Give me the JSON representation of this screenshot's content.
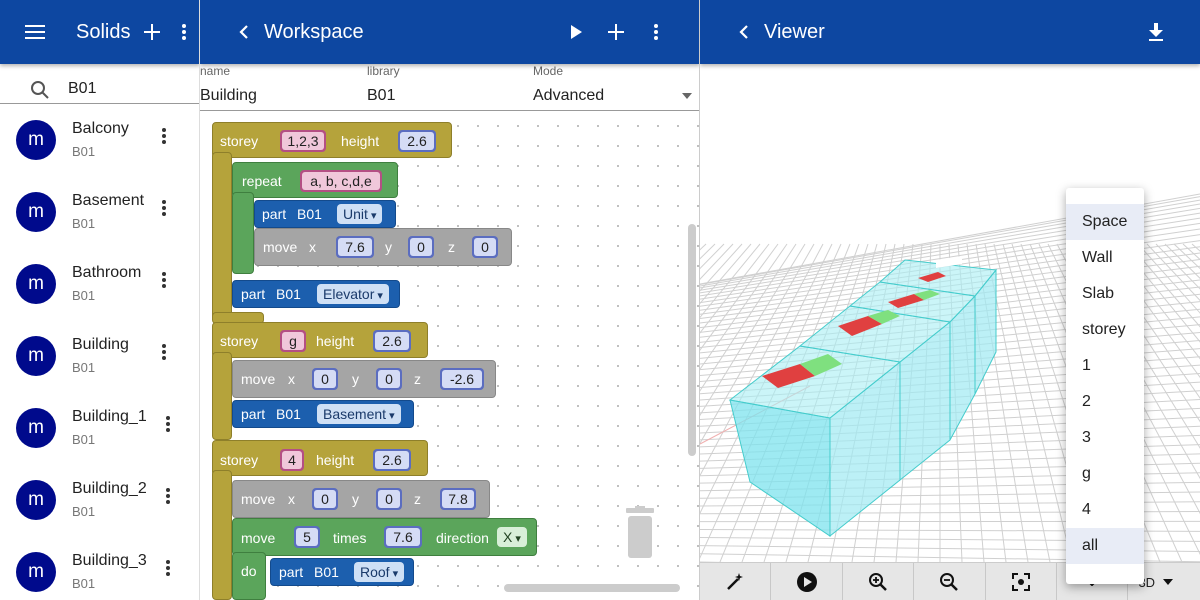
{
  "left": {
    "title": "Solids",
    "search_value": "B01",
    "items": [
      {
        "avatar": "m",
        "name": "Balcony",
        "sub": "B01"
      },
      {
        "avatar": "m",
        "name": "Basement",
        "sub": "B01"
      },
      {
        "avatar": "m",
        "name": "Bathroom",
        "sub": "B01"
      },
      {
        "avatar": "m",
        "name": "Building",
        "sub": "B01"
      },
      {
        "avatar": "m",
        "name": "Building_1",
        "sub": "B01"
      },
      {
        "avatar": "m",
        "name": "Building_2",
        "sub": "B01"
      },
      {
        "avatar": "m",
        "name": "Building_3",
        "sub": "B01"
      }
    ]
  },
  "workspace": {
    "title": "Workspace",
    "fields": {
      "name_label": "name",
      "name_value": "Building",
      "library_label": "library",
      "library_value": "B01",
      "mode_label": "Mode",
      "mode_value": "Advanced"
    },
    "blocks": {
      "storey": "storey",
      "height": "height",
      "repeat": "repeat",
      "part": "part",
      "move": "move",
      "x": "x",
      "y": "y",
      "z": "z",
      "times": "times",
      "direction": "direction",
      "do": "do",
      "s1_levels": "1,2,3",
      "s1_height": "2.6",
      "repeat_list": "a, b, c,d,e",
      "part1_lib": "B01",
      "part1_name": "Unit",
      "move1_x": "7.6",
      "move1_y": "0",
      "move1_z": "0",
      "part2_lib": "B01",
      "part2_name": "Elevator",
      "s2_level": "g",
      "s2_height": "2.6",
      "move2_x": "0",
      "move2_y": "0",
      "move2_z": "-2.6",
      "part3_lib": "B01",
      "part3_name": "Basement",
      "s3_level": "4",
      "s3_height": "2.6",
      "move3_x": "0",
      "move3_y": "0",
      "move3_z": "7.8",
      "move4_count": "5",
      "move4_dist": "7.6",
      "move4_dir": "X",
      "part4_lib": "B01",
      "part4_name": "Roof"
    }
  },
  "viewer": {
    "title": "Viewer",
    "view_mode": "3D",
    "menu": [
      "Space",
      "Wall",
      "Slab",
      "storey",
      "1",
      "2",
      "3",
      "g",
      "4",
      "all"
    ],
    "menu_selected": [
      "Space",
      "all"
    ],
    "colors": {
      "appbar": "#0d47a1",
      "avatar": "#000a8c"
    }
  }
}
